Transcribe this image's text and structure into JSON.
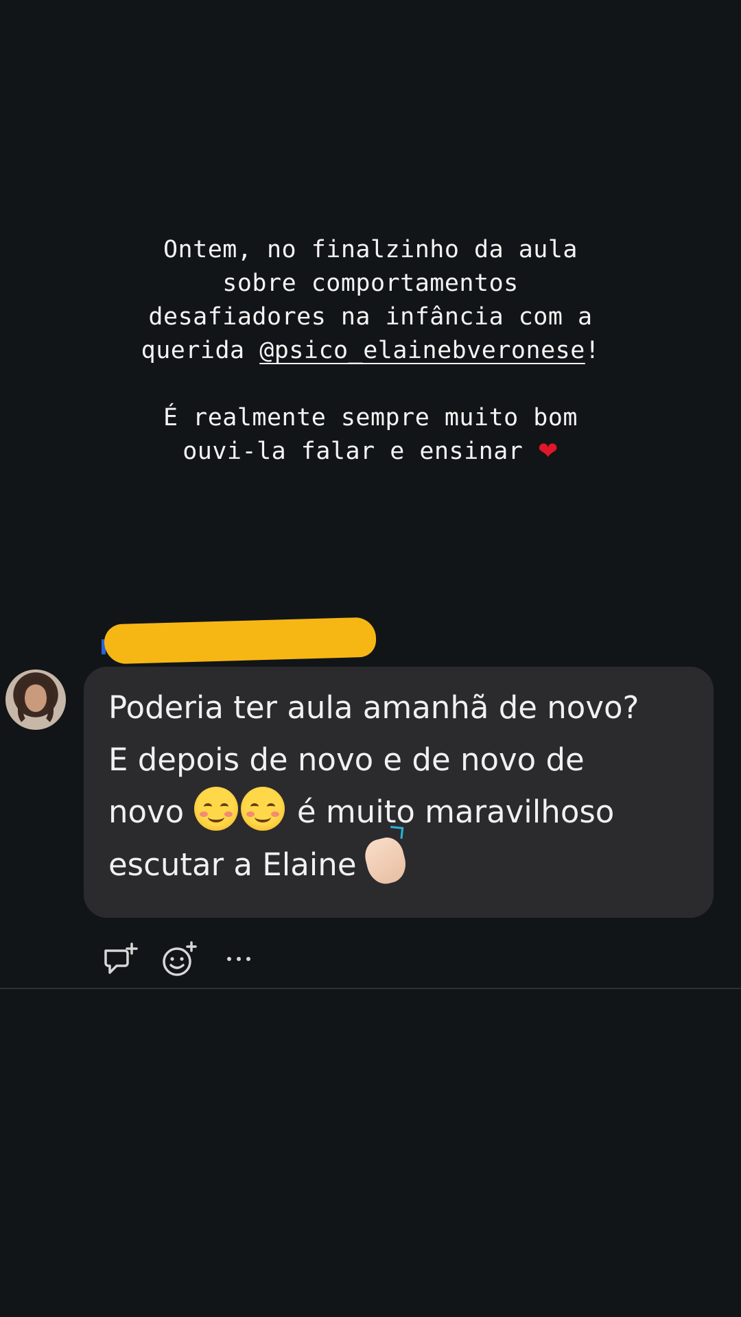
{
  "story": {
    "caption_lines": [
      "Ontem, no finalzinho da aula",
      "sobre comportamentos",
      "desafiadores na infância com a"
    ],
    "caption_prefix": "querida ",
    "mention": "@psico_elainebveronese",
    "mention_suffix": "!",
    "caption_line5": "É realmente sempre muito bom",
    "caption_line6": "ouvi-la falar e ensinar",
    "heart_icon": "❤"
  },
  "comment": {
    "line1": "Poderia ter aula amanhã de novo?",
    "line2": "E depois de novo e de novo de",
    "line3_start": "novo",
    "line3_end": "é muito maravilhoso",
    "line4": "escutar a Elaine",
    "redaction_color": "#f6b715",
    "emoji_icons": [
      "smiling-face-icon",
      "smiling-face-icon",
      "clapping-hands-icon"
    ]
  },
  "actions": {
    "reply_icon": "comment-plus-icon",
    "react_icon": "emoji-plus-icon",
    "more_icon": "ellipsis-icon"
  },
  "colors": {
    "background": "#121517",
    "bubble": "#2b2b2e",
    "text": "#f1f1f1"
  }
}
